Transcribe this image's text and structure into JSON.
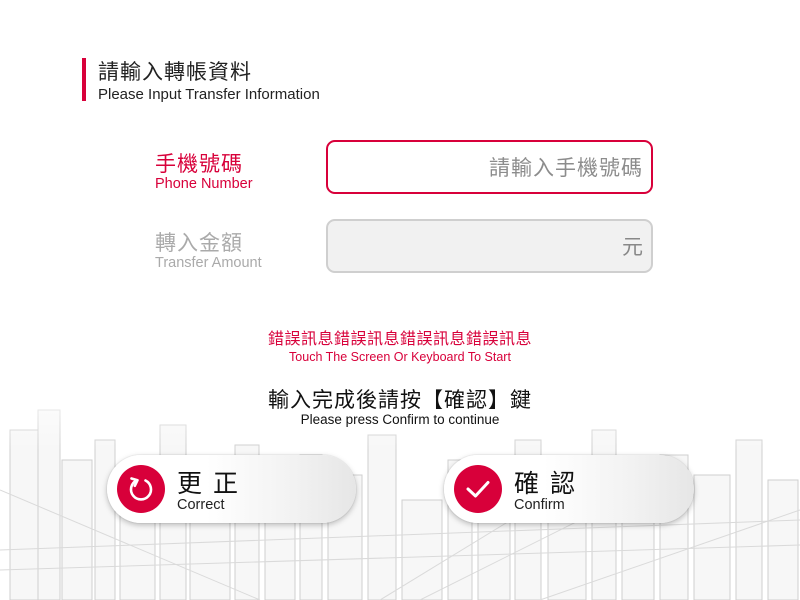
{
  "header": {
    "title": "請輸入轉帳資料",
    "subtitle": "Please Input Transfer Information"
  },
  "form": {
    "phone": {
      "label_zh": "手機號碼",
      "label_en": "Phone Number",
      "placeholder": "請輸入手機號碼",
      "value": ""
    },
    "amount": {
      "label_zh": "轉入金額",
      "label_en": "Transfer Amount",
      "unit": "元",
      "value": ""
    }
  },
  "messages": {
    "error_zh": "錯誤訊息錯誤訊息錯誤訊息錯誤訊息",
    "error_en": "Touch The Screen Or Keyboard To Start",
    "instruction_zh": "輸入完成後請按【確認】鍵",
    "instruction_en": "Please press Confirm to continue"
  },
  "buttons": {
    "correct": {
      "label_zh": "更 正",
      "label_en": "Correct",
      "icon": "undo-icon"
    },
    "confirm": {
      "label_zh": "確 認",
      "label_en": "Confirm",
      "icon": "check-icon"
    }
  },
  "colors": {
    "accent": "#d8003a",
    "disabled_text": "#aaaaaa",
    "disabled_field_bg": "#f1f1f1"
  }
}
